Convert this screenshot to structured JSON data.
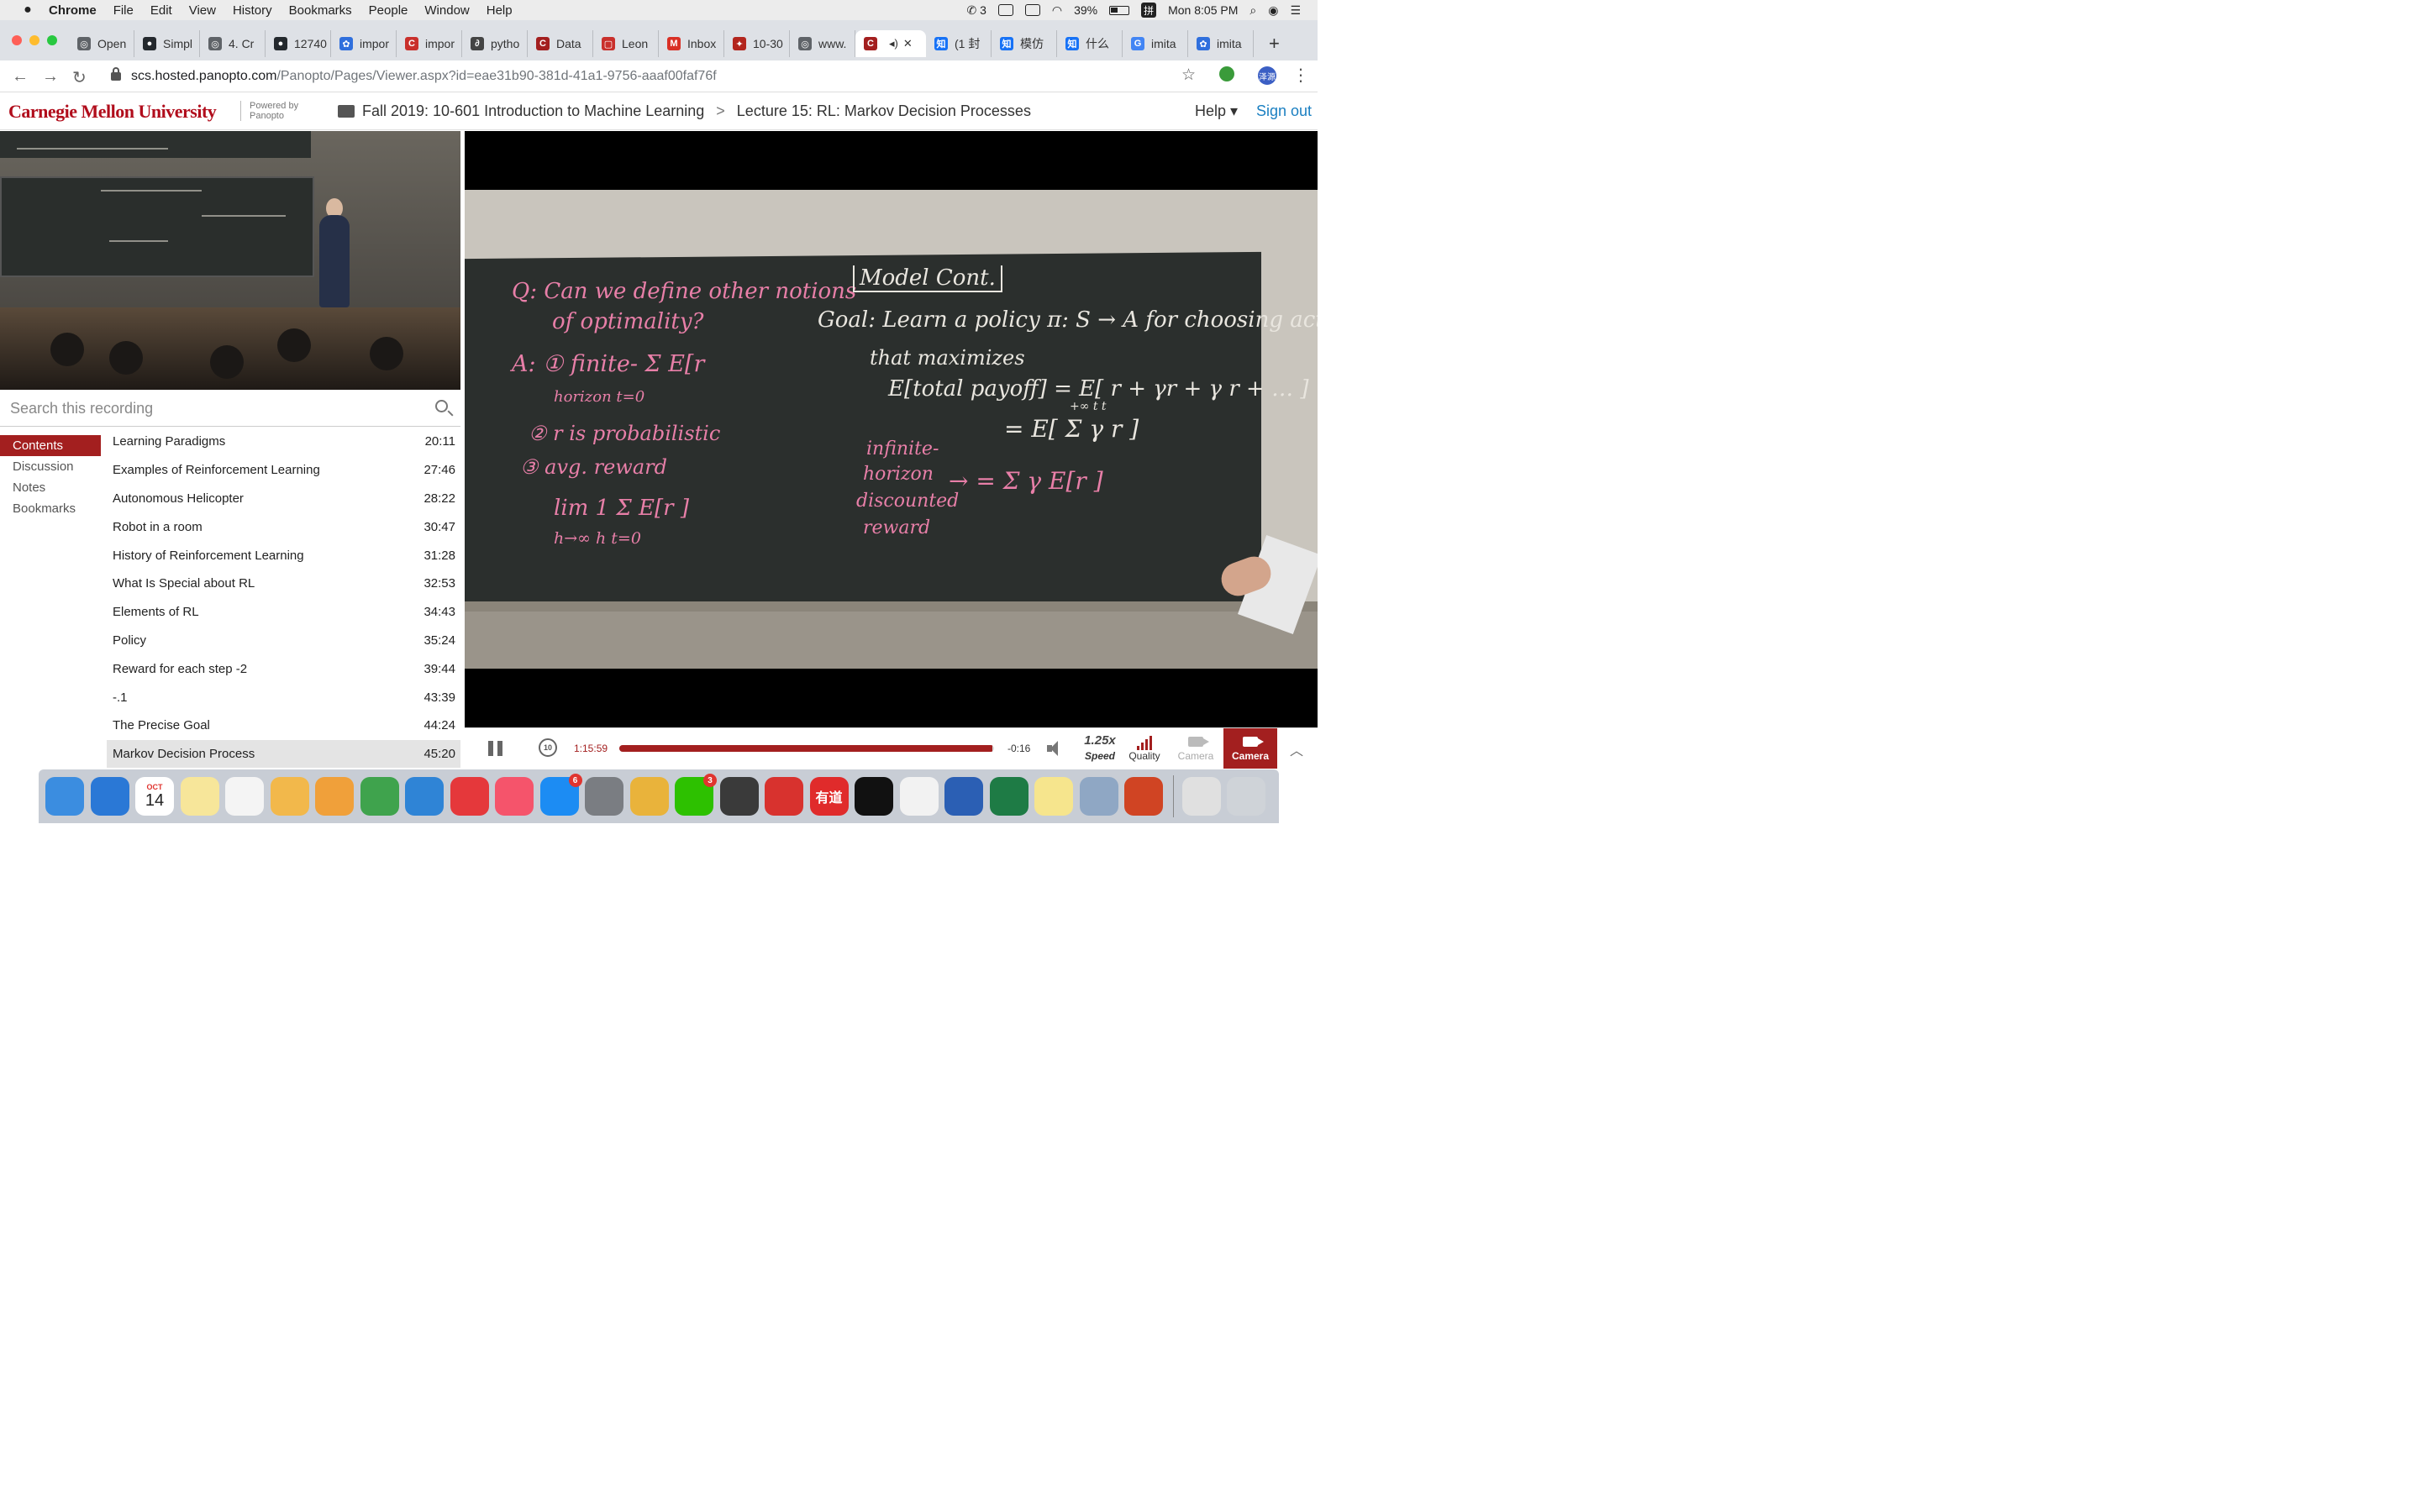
{
  "menubar": {
    "apple_icon": "apple-icon",
    "items": [
      "Chrome",
      "File",
      "Edit",
      "View",
      "History",
      "Bookmarks",
      "People",
      "Window",
      "Help"
    ],
    "wechat_count": "3",
    "battery": "39%",
    "ime": "拼",
    "clock": "Mon 8:05 PM"
  },
  "tabs": [
    {
      "label": "Open",
      "color": "#5f6368",
      "glyph": "◎"
    },
    {
      "label": "Simpl",
      "color": "#24292e",
      "glyph": "●"
    },
    {
      "label": "4. Cr",
      "color": "#5f6368",
      "glyph": "◎"
    },
    {
      "label": "12740",
      "color": "#24292e",
      "glyph": "●"
    },
    {
      "label": "impor",
      "color": "#2f6fdd",
      "glyph": "✿"
    },
    {
      "label": "impor",
      "color": "#c9302c",
      "glyph": "C"
    },
    {
      "label": "pytho",
      "color": "#444444",
      "glyph": "∂"
    },
    {
      "label": "Data",
      "color": "#a31f1f",
      "glyph": "C"
    },
    {
      "label": "Leon",
      "color": "#c9302c",
      "glyph": "▢"
    },
    {
      "label": "Inbox",
      "color": "#d93025",
      "glyph": "M"
    },
    {
      "label": "10-30",
      "color": "#b3261e",
      "glyph": "✦"
    },
    {
      "label": "www.",
      "color": "#5f6368",
      "glyph": "◎"
    },
    {
      "label": "",
      "color": "#a31f1f",
      "glyph": "C",
      "active": true
    },
    {
      "label": "(1 封",
      "color": "#1772f6",
      "glyph": "知"
    },
    {
      "label": "模仿",
      "color": "#1772f6",
      "glyph": "知"
    },
    {
      "label": "什么",
      "color": "#1772f6",
      "glyph": "知"
    },
    {
      "label": "imita",
      "color": "#4285f4",
      "glyph": "G"
    },
    {
      "label": "imita",
      "color": "#2f6fdd",
      "glyph": "✿"
    }
  ],
  "address": {
    "host": "scs.hosted.panopto.com",
    "path": "/Panopto/Pages/Viewer.aspx?id=eae31b90-381d-41a1-9756-aaaf00faf76f",
    "profile": "泽源"
  },
  "header": {
    "logo": "Carnegie Mellon University",
    "powered_line1": "Powered by",
    "powered_line2": "Panopto",
    "folder": "Fall 2019: 10-601 Introduction to Machine Learning",
    "separator": ">",
    "session": "Lecture 15: RL: Markov Decision Processes",
    "help": "Help ▾",
    "sign_out": "Sign out"
  },
  "search": {
    "placeholder": "Search this recording"
  },
  "sidenav": [
    "Contents",
    "Discussion",
    "Notes",
    "Bookmarks"
  ],
  "contents": [
    {
      "title": "Learning Paradigms",
      "time": "20:11"
    },
    {
      "title": "Examples of Reinforcement Learning",
      "time": "27:46"
    },
    {
      "title": "Autonomous Helicopter",
      "time": "28:22"
    },
    {
      "title": "Robot in a room",
      "time": "30:47"
    },
    {
      "title": "History of Reinforcement Learning",
      "time": "31:28"
    },
    {
      "title": "What Is Special about RL",
      "time": "32:53"
    },
    {
      "title": "Elements of RL",
      "time": "34:43"
    },
    {
      "title": "Policy",
      "time": "35:24"
    },
    {
      "title": "Reward for each step -2",
      "time": "39:44"
    },
    {
      "title": "-.1",
      "time": "43:39"
    },
    {
      "title": "The Precise Goal",
      "time": "44:24"
    },
    {
      "title": "Markov Decision Process",
      "time": "45:20"
    }
  ],
  "board": {
    "q1": "Q: Can we define other notions",
    "q2": "of optimality?",
    "a1": "A: ① finite-  Σ  E[r",
    "a1b": "horizon  t=0",
    "a2": "② r   is probabilistic",
    "a3": "③ avg. reward",
    "a4": "lim   1   Σ  E[r  ]",
    "a4b": "h→∞  h   t=0",
    "model": "Model Cont.",
    "goal": "Goal: Learn a policy  π: S → A  for choosing actions",
    "goal2": "that maximizes",
    "e1": "E[total payoff] = E[ r  + γr  + γ r  + … ]",
    "e2": "= E[ Σ  γ  r  ]",
    "e2b": "+∞   t      t",
    "inf1": "infinite-",
    "inf2": "horizon",
    "inf3": "discounted",
    "inf4": "reward",
    "e3": "→  =  Σ  γ E[r  ]"
  },
  "player": {
    "elapsed": "1:15:59",
    "remaining": "-0:16",
    "progress_fraction": 0.9965,
    "rewind_label": "10",
    "speed_value": "1.25x",
    "speed_label": "Speed",
    "quality_label": "Quality",
    "camera_label_disabled": "Camera",
    "camera_label_active": "Camera",
    "accent": "#a31f1f"
  },
  "dock": {
    "calendar_month": "OCT",
    "calendar_day": "14",
    "appstore_badge": "6",
    "wechat_badge": "3",
    "youdao_label": "有道",
    "apps": [
      {
        "name": "finder-icon",
        "color": "#3b8de0"
      },
      {
        "name": "safari-icon",
        "color": "#2a78d6"
      },
      {
        "name": "calendar-icon",
        "color": "#ffffff"
      },
      {
        "name": "notes-icon",
        "color": "#f7e69a"
      },
      {
        "name": "reminders-icon",
        "color": "#f4f4f4"
      },
      {
        "name": "photos-icon",
        "color": "#f2b84b"
      },
      {
        "name": "pages-icon",
        "color": "#f0a03a"
      },
      {
        "name": "numbers-icon",
        "color": "#3fa34d"
      },
      {
        "name": "keynote-icon",
        "color": "#2f84d6"
      },
      {
        "name": "news-icon",
        "color": "#e5383b"
      },
      {
        "name": "music-icon",
        "color": "#f5546b"
      },
      {
        "name": "app-store-icon",
        "color": "#1c8cf3"
      },
      {
        "name": "system-preferences-icon",
        "color": "#7a7d82"
      },
      {
        "name": "chrome-icon",
        "color": "#e9b33b"
      },
      {
        "name": "wechat-icon",
        "color": "#2dc100"
      },
      {
        "name": "sublime-text-icon",
        "color": "#3a3a3a"
      },
      {
        "name": "netease-music-icon",
        "color": "#d8322e"
      },
      {
        "name": "youdao-icon",
        "color": "#e02b2b"
      },
      {
        "name": "terminal-icon",
        "color": "#111111"
      },
      {
        "name": "textedit-icon",
        "color": "#f2f2f2"
      },
      {
        "name": "word-icon",
        "color": "#2b5fb4"
      },
      {
        "name": "excel-icon",
        "color": "#1e7b45"
      },
      {
        "name": "stickies-icon",
        "color": "#f6e58d"
      },
      {
        "name": "preview-icon",
        "color": "#8fa7c4"
      },
      {
        "name": "powerpoint-icon",
        "color": "#d04423"
      },
      {
        "name": "downloads-icon",
        "color": "#e0e0e0"
      },
      {
        "name": "trash-icon",
        "color": "#cfd3d8"
      }
    ]
  }
}
